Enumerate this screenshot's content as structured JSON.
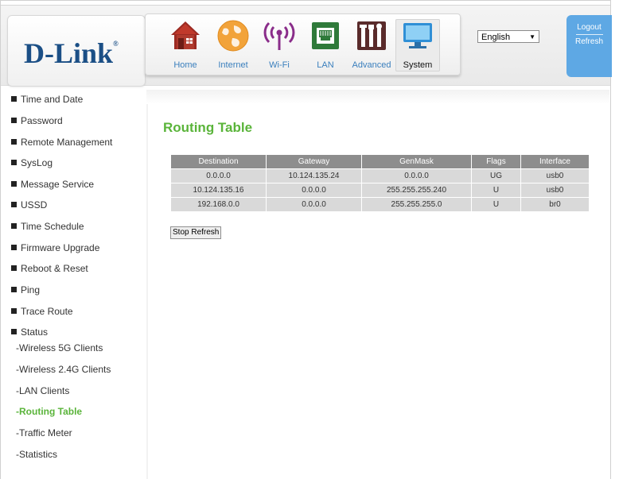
{
  "brand": {
    "logo_text": "D-Link",
    "logo_mark": "®",
    "accent": "#1b4f86"
  },
  "nav": [
    {
      "label": "Home",
      "icon": "home-icon"
    },
    {
      "label": "Internet",
      "icon": "globe-icon"
    },
    {
      "label": "Wi-Fi",
      "icon": "wifi-icon"
    },
    {
      "label": "LAN",
      "icon": "lan-port-icon"
    },
    {
      "label": "Advanced",
      "icon": "tools-icon"
    },
    {
      "label": "System",
      "icon": "monitor-icon"
    }
  ],
  "language": {
    "selected": "English"
  },
  "account": {
    "logout": "Logout",
    "refresh": "Refresh"
  },
  "sidebar": {
    "items": [
      "Time and Date",
      "Password",
      "Remote Management",
      "SysLog",
      "Message Service",
      "USSD",
      "Time Schedule",
      "Firmware Upgrade",
      "Reboot & Reset",
      "Ping",
      "Trace Route",
      "Status"
    ],
    "status_sub": [
      "-Wireless 5G Clients",
      "-Wireless 2.4G Clients",
      "-LAN Clients",
      "-Routing Table",
      "-Traffic Meter",
      "-Statistics"
    ],
    "active_sub": "-Routing Table"
  },
  "page": {
    "title": "Routing Table",
    "title_color": "#5ab43a",
    "table": {
      "headers": [
        "Destination",
        "Gateway",
        "GenMask",
        "Flags",
        "Interface"
      ],
      "rows": [
        [
          "0.0.0.0",
          "10.124.135.24",
          "0.0.0.0",
          "UG",
          "usb0"
        ],
        [
          "10.124.135.16",
          "0.0.0.0",
          "255.255.255.240",
          "U",
          "usb0"
        ],
        [
          "192.168.0.0",
          "0.0.0.0",
          "255.255.255.0",
          "U",
          "br0"
        ]
      ]
    },
    "stop_refresh": "Stop Refresh"
  }
}
